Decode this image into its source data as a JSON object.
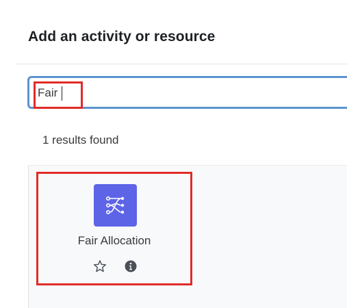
{
  "modal": {
    "title": "Add an activity or resource"
  },
  "search": {
    "value": "Fair"
  },
  "results": {
    "count_text": "1 results found",
    "items": [
      {
        "name": "Fair Allocation",
        "icon": "fair-allocation-icon",
        "icon_color": "#5e64e6",
        "actions": [
          "star-icon",
          "info-icon"
        ]
      }
    ]
  },
  "highlights": {
    "color": "#e02b27"
  },
  "colors": {
    "search_border": "#5b93ce",
    "results_background": "#f8f9fa"
  }
}
